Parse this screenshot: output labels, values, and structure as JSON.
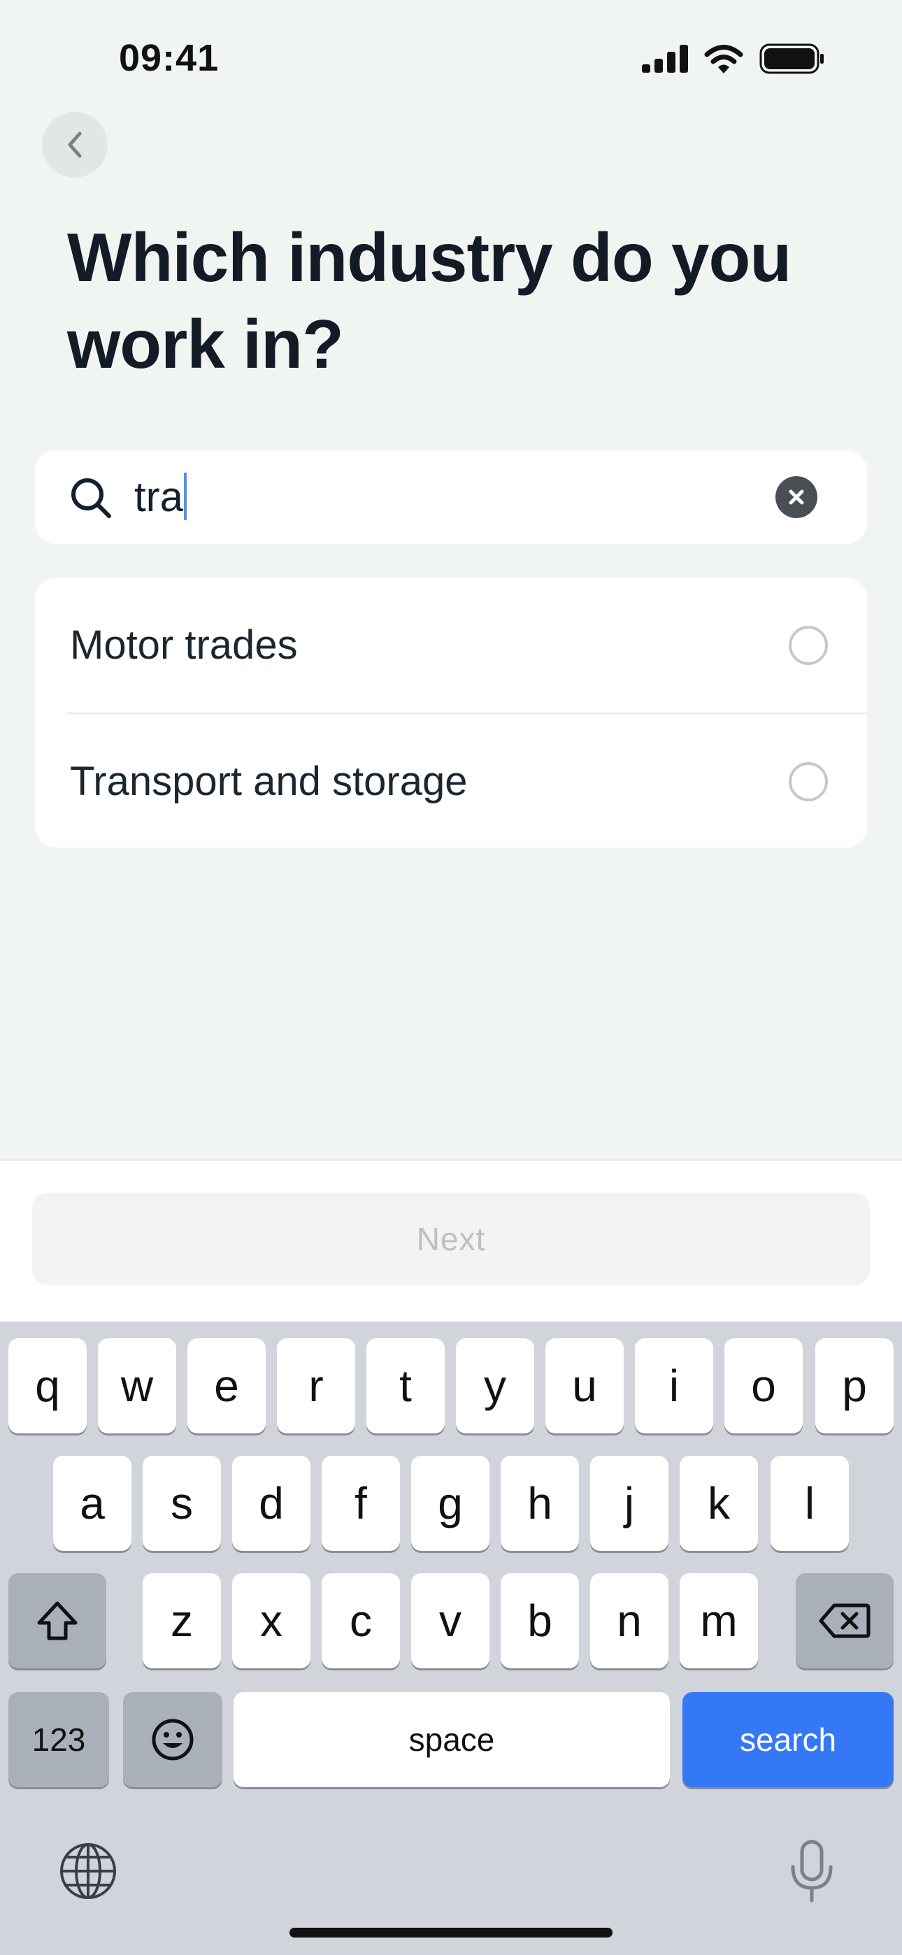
{
  "status_bar": {
    "time": "09:41"
  },
  "header": {
    "title": "Which industry do you work in?"
  },
  "search": {
    "value": "tra"
  },
  "results": [
    {
      "label": "Motor trades",
      "selected": false
    },
    {
      "label": "Transport and storage",
      "selected": false
    }
  ],
  "next_button": {
    "label": "Next",
    "enabled": false
  },
  "keyboard": {
    "row1": [
      "q",
      "w",
      "e",
      "r",
      "t",
      "y",
      "u",
      "i",
      "o",
      "p"
    ],
    "row2": [
      "a",
      "s",
      "d",
      "f",
      "g",
      "h",
      "j",
      "k",
      "l"
    ],
    "row3": [
      "z",
      "x",
      "c",
      "v",
      "b",
      "n",
      "m"
    ],
    "numbers_label": "123",
    "space_label": "space",
    "action_label": "search"
  },
  "colors": {
    "background": "#f1f5f1",
    "accent": "#3478f6",
    "title": "#131c26"
  },
  "icons": [
    "back-chevron-icon",
    "search-icon",
    "clear-icon",
    "radio-icon",
    "shift-icon",
    "backspace-icon",
    "emoji-icon",
    "globe-icon",
    "microphone-icon"
  ]
}
